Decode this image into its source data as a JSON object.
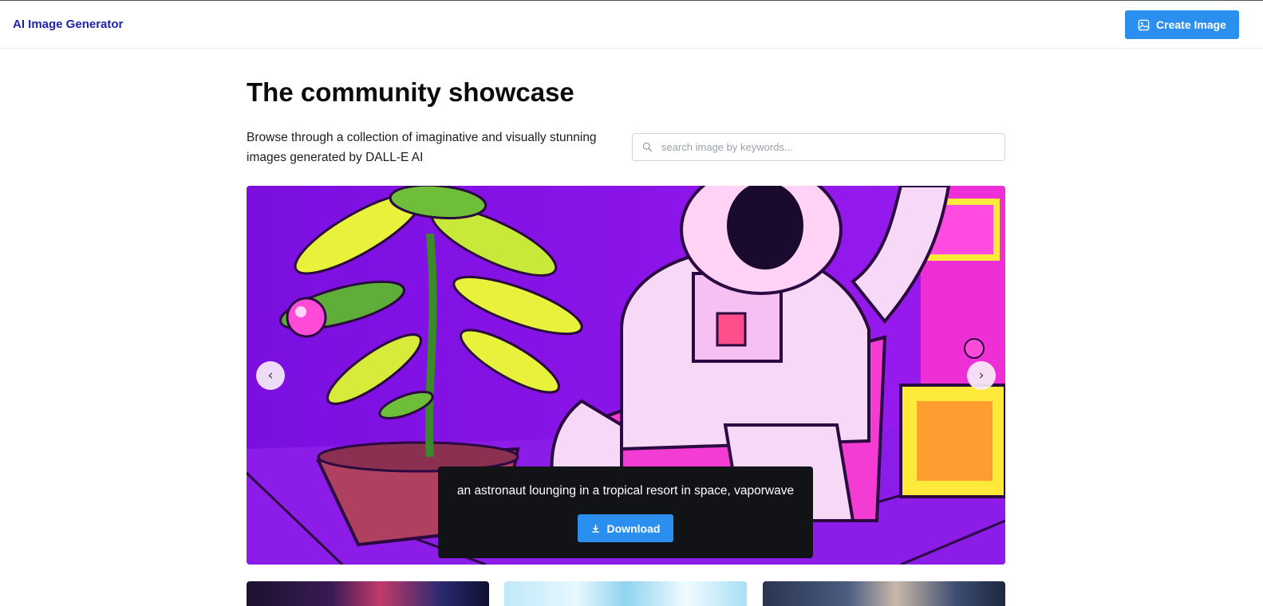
{
  "app": {
    "brand": "AI Image Generator",
    "create_button_label": "Create Image"
  },
  "hero": {
    "title": "The community showcase",
    "description": "Browse through a collection of imaginative and visually stunning images generated by DALL-E AI"
  },
  "search": {
    "placeholder": "search image by keywords...",
    "value": ""
  },
  "carousel": {
    "caption": "an astronaut lounging in a tropical resort in space, vaporwave",
    "download_label": "Download",
    "prev_glyph": "‹",
    "next_glyph": "›"
  },
  "colors": {
    "accent": "#2b8ff0",
    "brand_text": "#1f22a8",
    "caption_bg": "#121316",
    "art_background": "#8a14e8"
  },
  "icons": [
    "image-icon",
    "search-icon",
    "download-icon",
    "chevron-left-icon",
    "chevron-right-icon"
  ]
}
